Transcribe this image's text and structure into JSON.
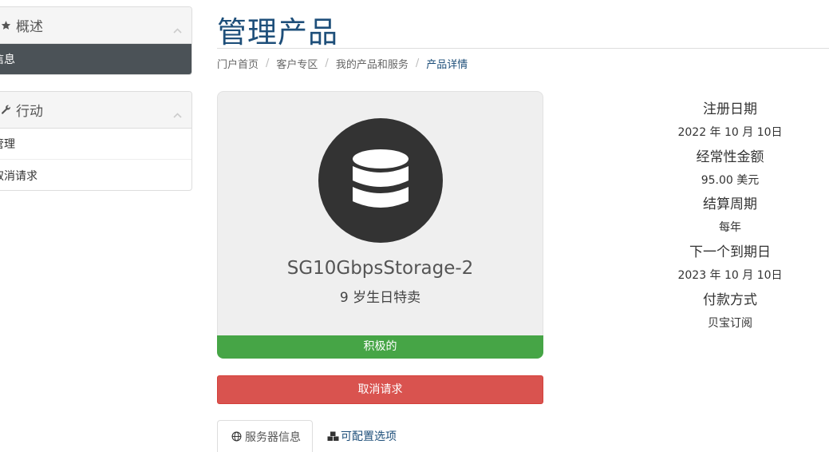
{
  "sidebar": {
    "overview": {
      "title": "概述",
      "active_item": "信息"
    },
    "actions": {
      "title": "行动",
      "items": [
        "管理",
        "取消请求"
      ]
    }
  },
  "header": {
    "title": "管理产品",
    "breadcrumb": [
      "门户首页",
      "客户专区",
      "我的产品和服务",
      "产品详情"
    ]
  },
  "product": {
    "name": "SG10GbpsStorage-2",
    "group": "9 岁生日特卖",
    "status": "积极的",
    "cancel_label": "取消请求",
    "icon": "database-icon"
  },
  "details": [
    {
      "label": "注册日期",
      "value": "2022 年 10 月 10日"
    },
    {
      "label": "经常性金额",
      "value": "95.00 美元"
    },
    {
      "label": "结算周期",
      "value": "每年"
    },
    {
      "label": "下一个到期日",
      "value": "2023 年 10 月 10日"
    },
    {
      "label": "付款方式",
      "value": "贝宝订阅"
    }
  ],
  "tabs": [
    {
      "label": "服务器信息",
      "icon": "globe-icon"
    },
    {
      "label": "可配置选项",
      "icon": "cubes-icon"
    }
  ],
  "colors": {
    "title": "#1e4f7a",
    "active_sidebar": "#4b5257",
    "status_active": "#46a546",
    "cancel": "#d9534f"
  }
}
